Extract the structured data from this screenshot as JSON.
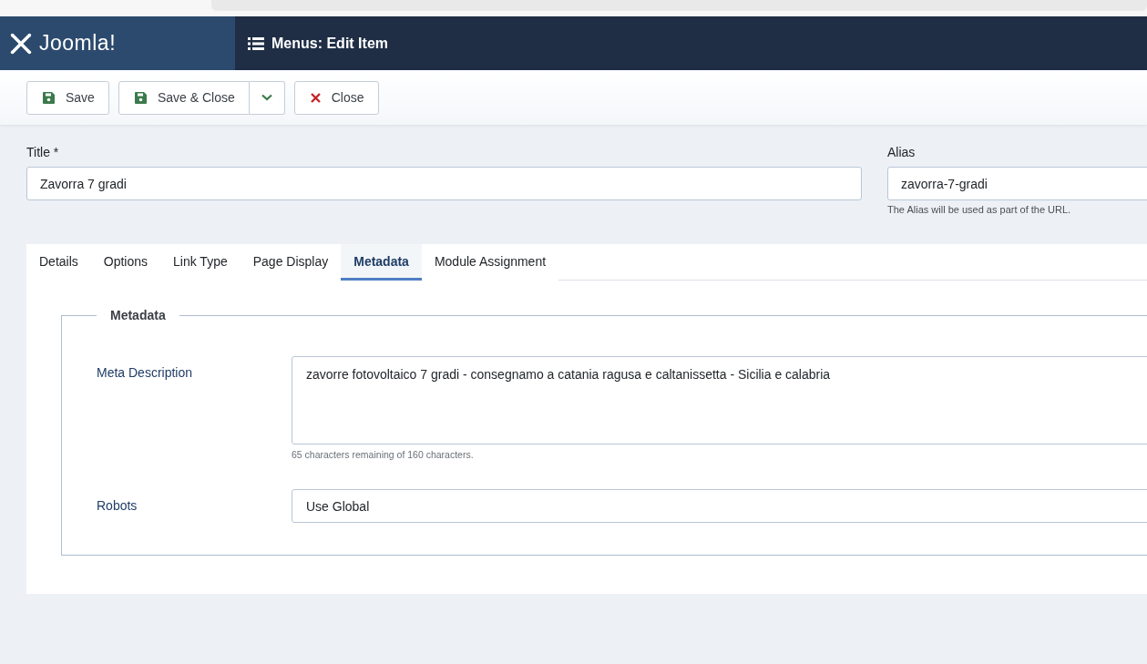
{
  "header": {
    "logo": "Joomla!",
    "title": "Menus: Edit Item"
  },
  "toolbar": [
    {
      "kind": "save",
      "label": "Save"
    },
    {
      "kind": "save-split",
      "label": "Save & Close"
    },
    {
      "kind": "close",
      "label": "Close"
    }
  ],
  "title_field": {
    "label": "Title *",
    "value": "Zavorra 7 gradi"
  },
  "alias_field": {
    "label": "Alias",
    "value": "zavorra-7-gradi",
    "hint": "The Alias will be used as part of the URL."
  },
  "tabs": [
    {
      "label": "Details",
      "selected": false
    },
    {
      "label": "Options",
      "selected": false
    },
    {
      "label": "Link Type",
      "selected": false
    },
    {
      "label": "Page Display",
      "selected": false
    },
    {
      "label": "Metadata",
      "selected": true
    },
    {
      "label": "Module Assignment",
      "selected": false
    }
  ],
  "fieldset": {
    "legend": "Metadata",
    "fields": [
      {
        "kind": "textarea",
        "label": "Meta Description",
        "value": "zavorre fotovoltaico 7 gradi - consegnamo a catania ragusa e caltanissetta - Sicilia e calabria",
        "hint": "65 characters remaining of 160 characters."
      },
      {
        "kind": "select",
        "label": "Robots",
        "value": "Use Global"
      }
    ]
  }
}
